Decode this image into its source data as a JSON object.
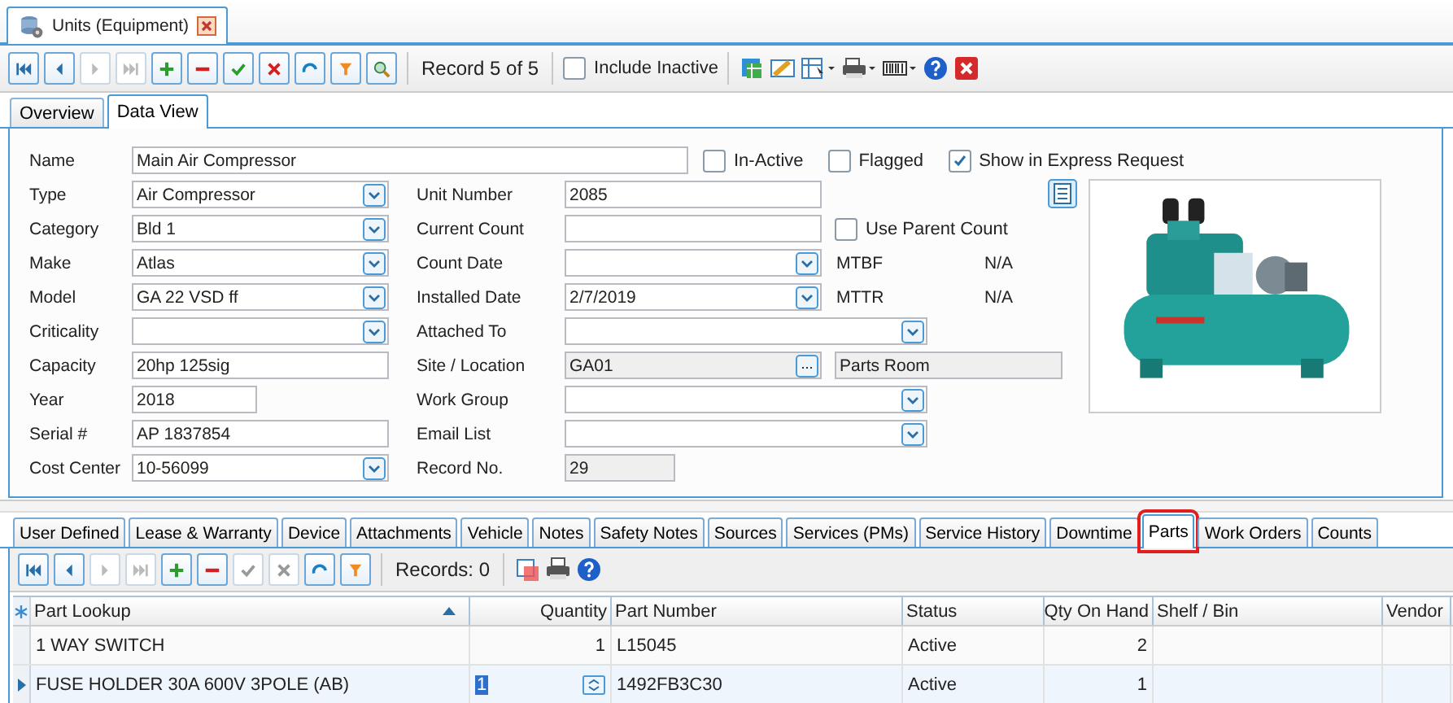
{
  "document_tab": {
    "title": "Units (Equipment)"
  },
  "toolbar": {
    "buttons": [
      {
        "kind": "first",
        "disabled": false
      },
      {
        "kind": "prev",
        "disabled": false
      },
      {
        "kind": "next",
        "disabled": true
      },
      {
        "kind": "last",
        "disabled": true
      },
      {
        "kind": "add",
        "disabled": false
      },
      {
        "kind": "delete",
        "disabled": false
      },
      {
        "kind": "save",
        "disabled": false
      },
      {
        "kind": "cancel",
        "disabled": false
      },
      {
        "kind": "refresh",
        "disabled": false
      },
      {
        "kind": "filter",
        "disabled": false
      },
      {
        "kind": "search",
        "disabled": false
      }
    ],
    "record_text": "Record 5 of 5",
    "include_inactive": {
      "label": "Include Inactive",
      "checked": false
    }
  },
  "view_tabs": [
    {
      "label": "Overview",
      "selected": false
    },
    {
      "label": "Data View",
      "selected": true
    }
  ],
  "form": {
    "name": {
      "label": "Name",
      "value": "Main Air Compressor"
    },
    "flags": [
      {
        "label": "In-Active",
        "checked": false
      },
      {
        "label": "Flagged",
        "checked": false
      },
      {
        "label": "Show in Express Request",
        "checked": true
      }
    ],
    "rows": [
      {
        "left": {
          "label": "Type",
          "value": "Air Compressor",
          "kind": "combo"
        },
        "right": {
          "label": "Unit Number",
          "value": "2085",
          "kind": "text"
        }
      },
      {
        "left": {
          "label": "Category",
          "value": "Bld 1",
          "kind": "combo"
        },
        "right": {
          "label": "Current Count",
          "kind": "text"
        },
        "side": {
          "kind": "checkbox",
          "label": "Use Parent Count",
          "checked": false
        }
      },
      {
        "left": {
          "label": "Make",
          "value": "Atlas",
          "kind": "combo"
        },
        "right": {
          "label": "Count Date",
          "kind": "combo"
        },
        "side": {
          "kind": "metric",
          "label": "MTBF",
          "value": "N/A"
        }
      },
      {
        "left": {
          "label": "Model",
          "value": "GA 22 VSD ff",
          "kind": "combo"
        },
        "right": {
          "label": "Installed Date",
          "value": "2/7/2019",
          "kind": "combo"
        },
        "side": {
          "kind": "metric",
          "label": "MTTR",
          "value": "N/A"
        }
      },
      {
        "left": {
          "label": "Criticality",
          "kind": "combo"
        },
        "right": {
          "label": "Attached To",
          "kind": "wide_combo"
        }
      },
      {
        "left": {
          "label": "Capacity",
          "value": "20hp 125sig",
          "kind": "text"
        },
        "right": {
          "label": "Site / Location",
          "value": "GA01",
          "kind": "lookup"
        },
        "side": {
          "kind": "readonly",
          "value": "Parts Room"
        }
      },
      {
        "left": {
          "label": "Year",
          "value": "2018",
          "kind": "short"
        },
        "right": {
          "label": "Work Group",
          "kind": "wide_combo"
        }
      },
      {
        "left": {
          "label": "Serial #",
          "value": "AP 1837854",
          "kind": "text"
        },
        "right": {
          "label": "Email List",
          "kind": "wide_combo"
        }
      },
      {
        "left": {
          "label": "Cost Center",
          "value": "10-56099",
          "kind": "combo"
        },
        "right": {
          "label": "Record No.",
          "value": "29",
          "kind": "readonly_short"
        }
      }
    ]
  },
  "detail_tabs": [
    {
      "label": "User Defined",
      "selected": false,
      "highlighted": false
    },
    {
      "label": "Lease & Warranty",
      "selected": false,
      "highlighted": false
    },
    {
      "label": "Device",
      "selected": false,
      "highlighted": false
    },
    {
      "label": "Attachments",
      "selected": false,
      "highlighted": false
    },
    {
      "label": "Vehicle",
      "selected": false,
      "highlighted": false
    },
    {
      "label": "Notes",
      "selected": false,
      "highlighted": false
    },
    {
      "label": "Safety Notes",
      "selected": false,
      "highlighted": false
    },
    {
      "label": "Sources",
      "selected": false,
      "highlighted": false
    },
    {
      "label": "Services (PMs)",
      "selected": false,
      "highlighted": false
    },
    {
      "label": "Service History",
      "selected": false,
      "highlighted": false
    },
    {
      "label": "Downtime",
      "selected": false,
      "highlighted": false
    },
    {
      "label": "Parts",
      "selected": true,
      "highlighted": true
    },
    {
      "label": "Work Orders",
      "selected": false,
      "highlighted": false
    },
    {
      "label": "Counts",
      "selected": false,
      "highlighted": false
    }
  ],
  "parts_toolbar": {
    "buttons": [
      {
        "kind": "first",
        "disabled": false
      },
      {
        "kind": "prev",
        "disabled": false
      },
      {
        "kind": "next",
        "disabled": true
      },
      {
        "kind": "last",
        "disabled": true
      },
      {
        "kind": "add",
        "disabled": false
      },
      {
        "kind": "delete",
        "disabled": false
      },
      {
        "kind": "save",
        "disabled": true
      },
      {
        "kind": "cancel",
        "disabled": true
      },
      {
        "kind": "refresh",
        "disabled": false
      },
      {
        "kind": "filter",
        "disabled": false
      }
    ],
    "records_text": "Records: 0"
  },
  "parts_table": {
    "columns": [
      {
        "label": "Part Lookup",
        "sorted": true
      },
      {
        "label": "Quantity",
        "sorted": false
      },
      {
        "label": "Part Number",
        "sorted": false
      },
      {
        "label": "Status",
        "sorted": false
      },
      {
        "label": "Qty On Hand",
        "sorted": false
      },
      {
        "label": "Shelf / Bin",
        "sorted": false
      },
      {
        "label": "Vendor",
        "sorted": false
      }
    ],
    "rows": [
      {
        "selected": false,
        "cells": [
          "1 WAY SWITCH",
          "1",
          "L15045",
          "Active",
          "2",
          "",
          ""
        ]
      },
      {
        "selected": true,
        "cells": [
          "FUSE HOLDER 30A 600V 3POLE (AB)",
          "1",
          "1492FB3C30",
          "Active",
          "1",
          "",
          ""
        ]
      }
    ]
  }
}
